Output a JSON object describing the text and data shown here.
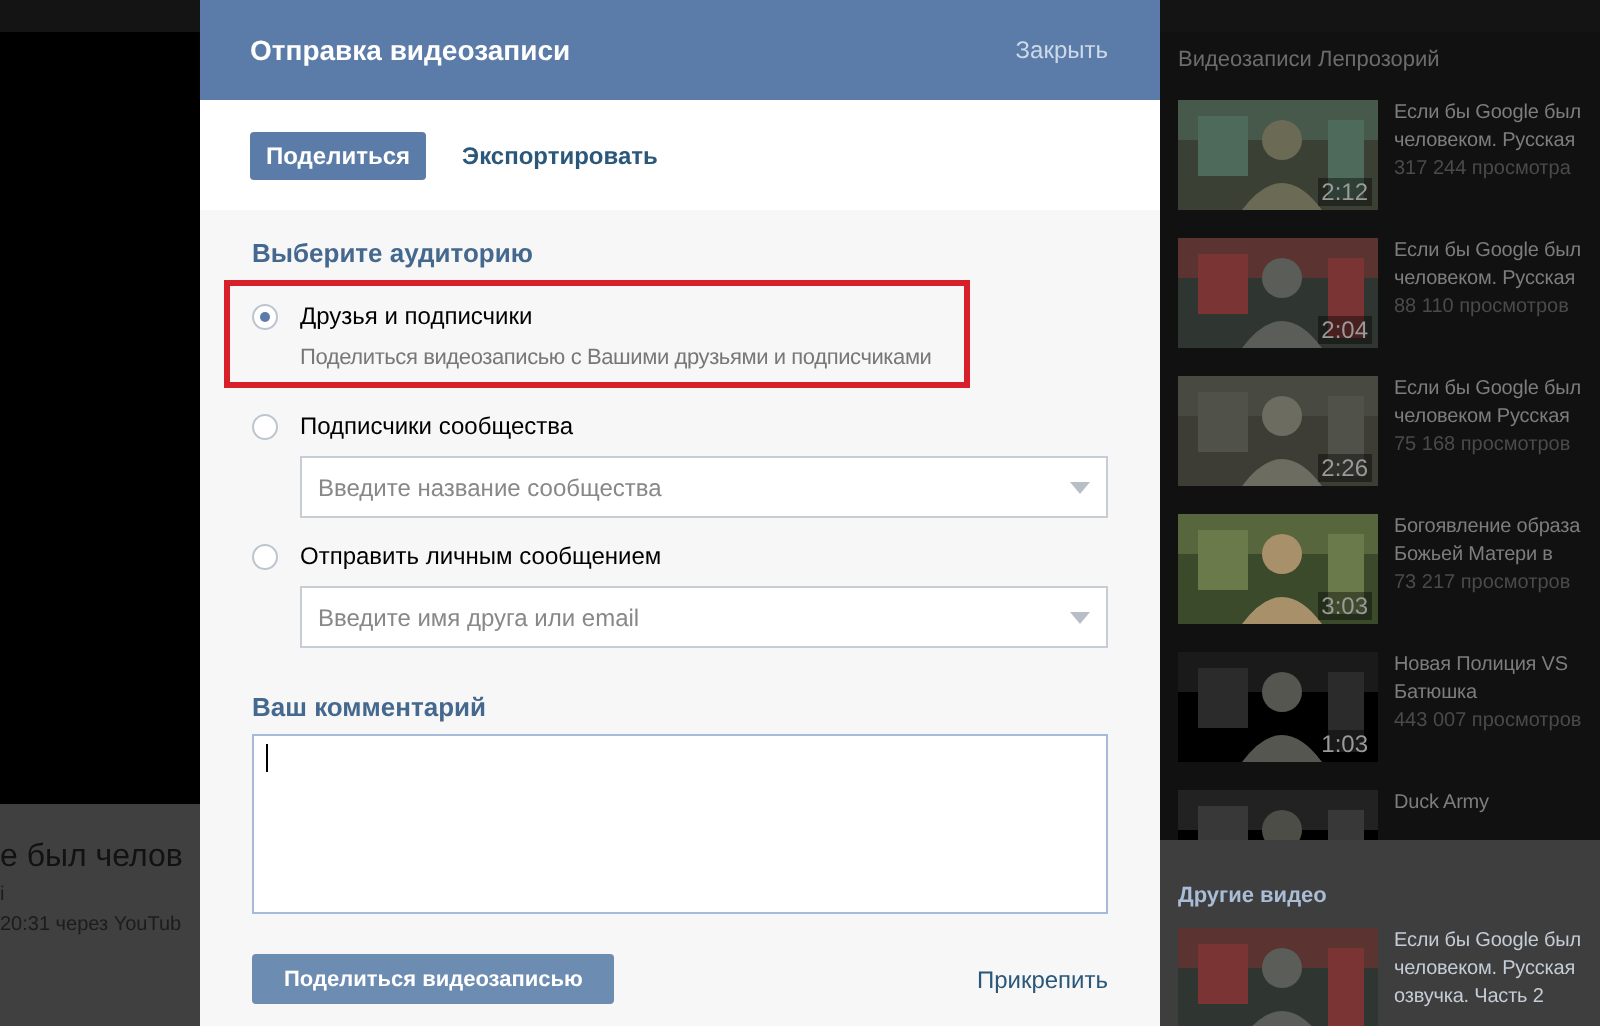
{
  "video_page": {
    "title_fragment": "е был челов",
    "author_fragment": "i",
    "meta_fragment": "20:31 через YouTub"
  },
  "sidebar": {
    "heading": "Видеозаписи Лепрозорий",
    "videos": [
      {
        "duration": "2:12",
        "title_lines": [
          "Если бы Google был",
          "человеком. Русская"
        ],
        "views": "317 244 просмотра"
      },
      {
        "duration": "2:04",
        "title_lines": [
          "Если бы Google был",
          "человеком. Русская"
        ],
        "views": "88 110 просмотров"
      },
      {
        "duration": "2:26",
        "title_lines": [
          "Если бы Google был",
          "человеком Русская"
        ],
        "views": "75 168 просмотров"
      },
      {
        "duration": "3:03",
        "title_lines": [
          "Богоявление образа",
          "Божьей Матери в"
        ],
        "views": "73 217 просмотров"
      },
      {
        "duration": "1:03",
        "title_lines": [
          "Новая Полиция VS",
          "Батюшка"
        ],
        "views": "443 007 просмотров"
      },
      {
        "title_lines": [
          "Duck Army"
        ]
      }
    ],
    "other_heading": "Другие видео",
    "other_videos": [
      {
        "title_lines": [
          "Если бы Google был",
          "человеком. Русская",
          "озвучка. Часть 2"
        ]
      }
    ]
  },
  "dialog": {
    "title": "Отправка видеозаписи",
    "close": "Закрыть",
    "tabs": [
      {
        "label": "Поделиться",
        "selected": true
      },
      {
        "label": "Экспортировать",
        "selected": false
      }
    ],
    "audience_heading": "Выберите аудиторию",
    "options": [
      {
        "label": "Друзья и подписчики",
        "selected": true,
        "highlighted": true,
        "description": "Поделиться видеозаписью с Вашими друзьями и подписчиками"
      },
      {
        "label": "Подписчики сообщества",
        "selected": false,
        "highlighted": false,
        "field_placeholder": "Введите название сообщества"
      },
      {
        "label": "Отправить личным сообщением",
        "selected": false,
        "highlighted": false,
        "field_placeholder": "Введите имя друга или email"
      }
    ],
    "comment_heading": "Ваш комментарий",
    "comment_focused": true,
    "submit": "Поделиться видеозаписью",
    "attach": "Прикрепить"
  }
}
